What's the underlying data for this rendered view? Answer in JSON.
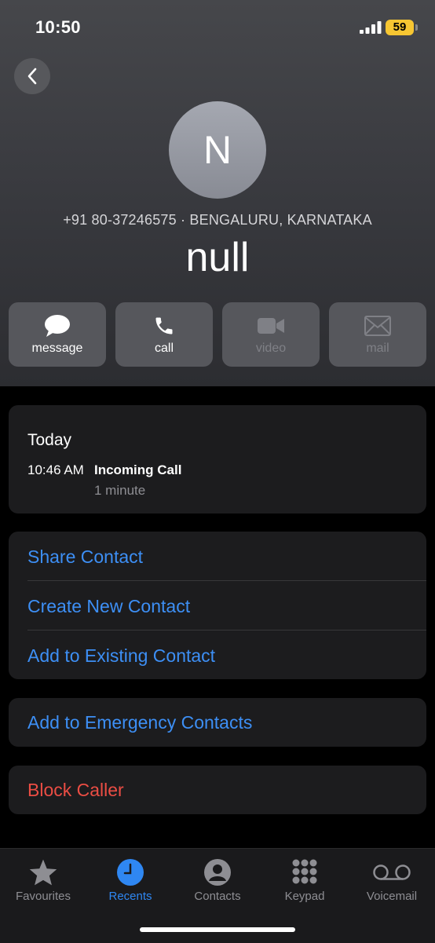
{
  "status_bar": {
    "time": "10:50",
    "battery": "59"
  },
  "contact": {
    "initial": "N",
    "subtitle": "+91 80-37246575 · BENGALURU, KARNATAKA",
    "name": "null"
  },
  "actions": [
    {
      "label": "message",
      "icon": "message-bubble-icon",
      "enabled": true
    },
    {
      "label": "call",
      "icon": "phone-icon",
      "enabled": true
    },
    {
      "label": "video",
      "icon": "video-camera-icon",
      "enabled": false
    },
    {
      "label": "mail",
      "icon": "envelope-icon",
      "enabled": false
    }
  ],
  "recent_call": {
    "day": "Today",
    "time": "10:46 AM",
    "type": "Incoming Call",
    "duration": "1 minute"
  },
  "options": {
    "share": "Share Contact",
    "create": "Create New Contact",
    "add_existing": "Add to Existing Contact",
    "emergency": "Add to Emergency Contacts",
    "block": "Block Caller"
  },
  "tabs": [
    {
      "label": "Favourites",
      "icon": "star-icon",
      "active": false
    },
    {
      "label": "Recents",
      "icon": "clock-icon",
      "active": true
    },
    {
      "label": "Contacts",
      "icon": "person-circle-icon",
      "active": false
    },
    {
      "label": "Keypad",
      "icon": "keypad-icon",
      "active": false
    },
    {
      "label": "Voicemail",
      "icon": "voicemail-icon",
      "active": false
    }
  ],
  "colors": {
    "accent": "#3d8ff5",
    "destructive": "#eb4d44",
    "battery": "#f7c632"
  }
}
